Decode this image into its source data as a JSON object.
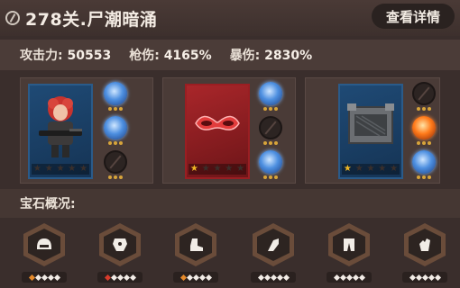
{
  "header": {
    "title": "278关.尸潮暗涌",
    "detail_label": "查看详情"
  },
  "stats": [
    {
      "label": "攻击力:",
      "value": "50553"
    },
    {
      "label": "枪伤:",
      "value": "4165%"
    },
    {
      "label": "暴伤:",
      "value": "2830%"
    }
  ],
  "slots": [
    {
      "card": {
        "kind": "hero",
        "color": "blue",
        "stars_lit": 0,
        "stars_total": 5
      },
      "chips": [
        {
          "type": "ice",
          "dots": 3
        },
        {
          "type": "ice",
          "dots": 3
        },
        {
          "type": "empty",
          "dots": 3
        }
      ]
    },
    {
      "card": {
        "kind": "mask",
        "color": "red",
        "stars_lit": 1,
        "stars_total": 5
      },
      "chips": [
        {
          "type": "ice",
          "dots": 3
        },
        {
          "type": "empty",
          "dots": 3
        },
        {
          "type": "ice",
          "dots": 3
        }
      ]
    },
    {
      "card": {
        "kind": "crate",
        "color": "blue",
        "stars_lit": 1,
        "stars_total": 5
      },
      "chips": [
        {
          "type": "empty",
          "dots": 3
        },
        {
          "type": "fire",
          "dots": 3
        },
        {
          "type": "ice",
          "dots": 3
        }
      ]
    }
  ],
  "gems_section": {
    "title": "宝石概况:",
    "gems": [
      {
        "icon": "helmet-icon",
        "pips": [
          "orange",
          "white",
          "white",
          "white",
          "white"
        ]
      },
      {
        "icon": "armor-icon",
        "pips": [
          "red",
          "white",
          "white",
          "white",
          "white"
        ]
      },
      {
        "icon": "boots-icon",
        "pips": [
          "orange",
          "white",
          "white",
          "white",
          "white"
        ]
      },
      {
        "icon": "gauntlet-icon",
        "pips": [
          "white",
          "white",
          "white",
          "white",
          "white"
        ]
      },
      {
        "icon": "pants-icon",
        "pips": [
          "white",
          "white",
          "white",
          "white",
          "white"
        ]
      },
      {
        "icon": "glove-icon",
        "pips": [
          "white",
          "white",
          "white",
          "white",
          "white"
        ]
      }
    ]
  },
  "colors": {
    "background": "#3a2e2c",
    "gold_star": "#f2b824",
    "dot": "#d7a43a"
  }
}
